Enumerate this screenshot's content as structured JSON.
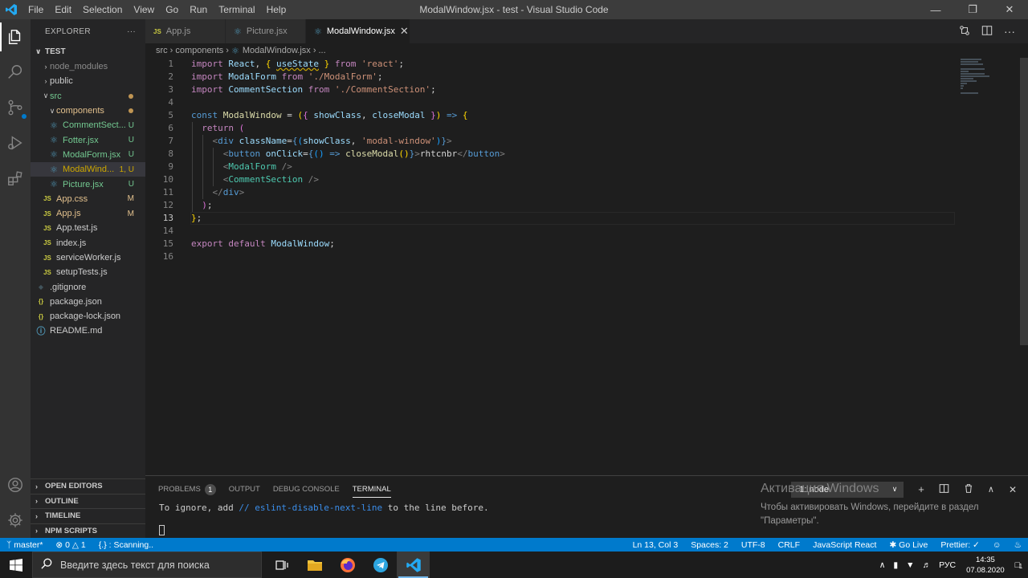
{
  "titlebar": {
    "menu": [
      "File",
      "Edit",
      "Selection",
      "View",
      "Go",
      "Run",
      "Terminal",
      "Help"
    ],
    "title": "ModalWindow.jsx - test - Visual Studio Code"
  },
  "sidebar": {
    "header": "EXPLORER",
    "more": "···",
    "root": "TEST",
    "items": [
      {
        "name": "node_modules",
        "color": "#8b8b8b",
        "badge": ""
      },
      {
        "name": "public",
        "color": "#cccccc",
        "badge": ""
      },
      {
        "name": "src",
        "color": "#73c991",
        "badge": ""
      },
      {
        "name": "components",
        "color": "#e2c08d",
        "badge": ""
      },
      {
        "name": "CommentSect...",
        "color": "#73c991",
        "badge": "U"
      },
      {
        "name": "Fotter.jsx",
        "color": "#73c991",
        "badge": "U"
      },
      {
        "name": "ModalForm.jsx",
        "color": "#73c991",
        "badge": "U"
      },
      {
        "name": "ModalWind...",
        "color": "#cca700",
        "badge": "1, U"
      },
      {
        "name": "Picture.jsx",
        "color": "#73c991",
        "badge": "U"
      },
      {
        "name": "App.css",
        "color": "#e2c08d",
        "badge": "M"
      },
      {
        "name": "App.js",
        "color": "#e2c08d",
        "badge": "M"
      },
      {
        "name": "App.test.js",
        "color": "#cccccc",
        "badge": ""
      },
      {
        "name": "index.js",
        "color": "#cccccc",
        "badge": ""
      },
      {
        "name": "serviceWorker.js",
        "color": "#cccccc",
        "badge": ""
      },
      {
        "name": "setupTests.js",
        "color": "#cccccc",
        "badge": ""
      },
      {
        "name": ".gitignore",
        "color": "#cccccc",
        "badge": ""
      },
      {
        "name": "package.json",
        "color": "#cccccc",
        "badge": ""
      },
      {
        "name": "package-lock.json",
        "color": "#cccccc",
        "badge": ""
      },
      {
        "name": "README.md",
        "color": "#cccccc",
        "badge": ""
      }
    ],
    "sections": [
      "OPEN EDITORS",
      "OUTLINE",
      "TIMELINE",
      "NPM SCRIPTS"
    ]
  },
  "tabs": [
    {
      "label": "App.js",
      "icon": "JS"
    },
    {
      "label": "Picture.jsx",
      "icon": "⚛"
    },
    {
      "label": "ModalWindow.jsx",
      "icon": "⚛"
    }
  ],
  "breadcrumb": [
    "src",
    "components",
    "ModalWindow.jsx",
    "..."
  ],
  "editor": {
    "line_numbers": [
      "1",
      "2",
      "3",
      "4",
      "5",
      "6",
      "7",
      "8",
      "9",
      "10",
      "11",
      "12",
      "13",
      "14",
      "15",
      "16"
    ],
    "current_line": 13
  },
  "panel": {
    "tabs": [
      "PROBLEMS",
      "OUTPUT",
      "DEBUG CONSOLE",
      "TERMINAL"
    ],
    "problems_count": "1",
    "terminal_select": "1: node",
    "terminal_text_pre": "To ignore, add ",
    "terminal_text_link": "// eslint-disable-next-line",
    "terminal_text_post": " to the line before."
  },
  "watermark": {
    "title": "Активация Windows",
    "line1": "Чтобы активировать Windows, перейдите в раздел",
    "line2": "\"Параметры\"."
  },
  "statusbar": {
    "branch": "master*",
    "errors": "0",
    "warnings": "1",
    "scanning": "{.} : Scanning..",
    "position": "Ln 13, Col 3",
    "spaces": "Spaces: 2",
    "encoding": "UTF-8",
    "eol": "CRLF",
    "language": "JavaScript React",
    "golive": "Go Live",
    "prettier": "Prettier: ✓"
  },
  "taskbar": {
    "search_placeholder": "Введите здесь текст для поиска",
    "lang": "РУС",
    "time": "14:35",
    "date": "07.08.2020",
    "notifications": "1"
  }
}
